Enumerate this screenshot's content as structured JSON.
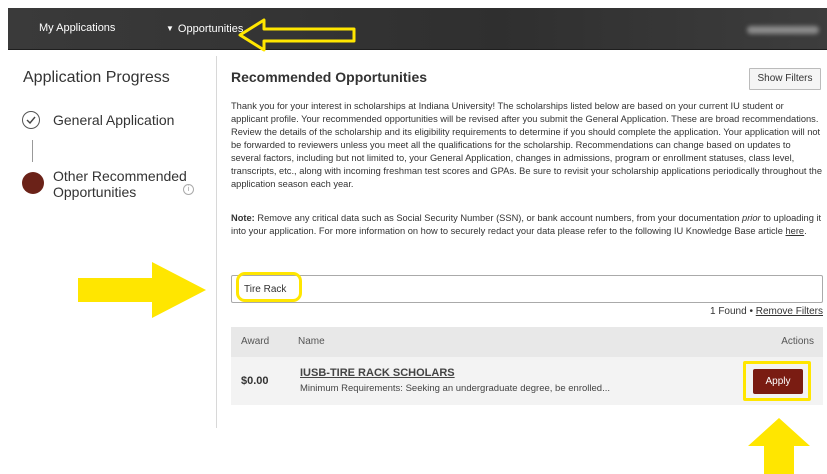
{
  "nav": {
    "my_applications": "My Applications",
    "opportunities": "Opportunities"
  },
  "sidebar": {
    "title": "Application Progress",
    "steps": [
      {
        "label": "General Application",
        "status": "complete"
      },
      {
        "label": "Other Recommended Opportunities",
        "status": "current"
      }
    ]
  },
  "main": {
    "title": "Recommended Opportunities",
    "show_filters": "Show Filters",
    "intro": "Thank you for your interest in scholarships at Indiana University! The scholarships listed below are based on your current IU student or applicant profile. Your recommended opportunities will be revised after you submit the General Application. These are broad recommendations. Review the details of the scholarship and its eligibility requirements to determine if you should complete the application. Your application will not be forwarded to reviewers unless you meet all the qualifications for the scholarship. Recommendations can change based on updates to several factors, including but not limited to, your General Application, changes in admissions, program or enrollment statuses, class level, transcripts, etc., along with incoming freshman test scores and GPAs. Be sure to revisit your scholarship applications periodically throughout the application season each year.",
    "note_label": "Note:",
    "note_part1": " Remove any critical data such as Social Security Number (SSN), or bank account numbers, from your documentation ",
    "note_italic": "prior",
    "note_part2": " to uploading it into your application. For more information on how to securely redact your data please refer to the following IU Knowledge Base article ",
    "note_link": "here",
    "note_end": ".",
    "search_value": "Tire Rack",
    "found_text": "1 Found",
    "separator": " • ",
    "remove_filters": "Remove Filters"
  },
  "table": {
    "headers": {
      "award": "Award",
      "name": "Name",
      "actions": "Actions"
    },
    "rows": [
      {
        "award": "$0.00",
        "name": "IUSB-TIRE RACK SCHOLARS",
        "requirements": "Minimum Requirements: Seeking an undergraduate degree, be enrolled...",
        "action": "Apply"
      }
    ]
  },
  "colors": {
    "nav_bg": "#333333",
    "accent": "#7a1c12",
    "highlight": "#ffe600"
  }
}
